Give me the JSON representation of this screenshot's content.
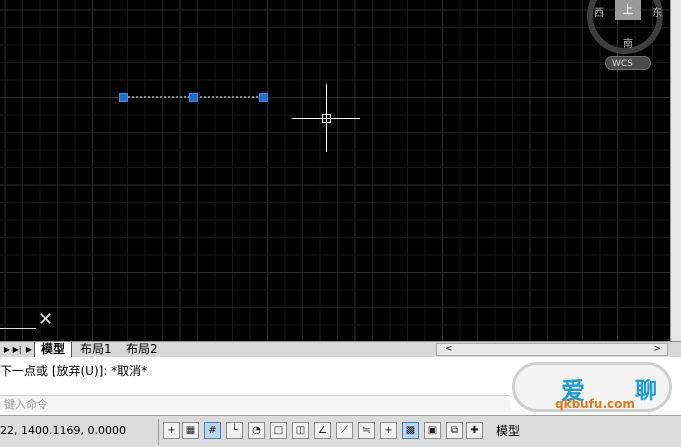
{
  "viewcube": {
    "west_label": "西",
    "top_label": "上",
    "east_label": "东",
    "south_label": "南",
    "wcs_label": "WCS"
  },
  "layout_tabs": {
    "tabs": [
      {
        "label": "模型",
        "active": true
      },
      {
        "label": "布局1",
        "active": false
      },
      {
        "label": "布局2",
        "active": false
      }
    ]
  },
  "command": {
    "history": "下一点或 [放弃(U)]: *取消*",
    "input_placeholder": "键入命令"
  },
  "status": {
    "coordinates": "22, 1400.1169, 0.0000",
    "model_label": "模型"
  },
  "watermark": {
    "site_text": "qkbufu.com",
    "brand_text": "爱",
    "brand_text2": "聊"
  },
  "colors": {
    "canvas": "#000000",
    "grip": "#1f6fd1",
    "grid_major": "#2e2e2e",
    "grid_minor": "#161616"
  }
}
